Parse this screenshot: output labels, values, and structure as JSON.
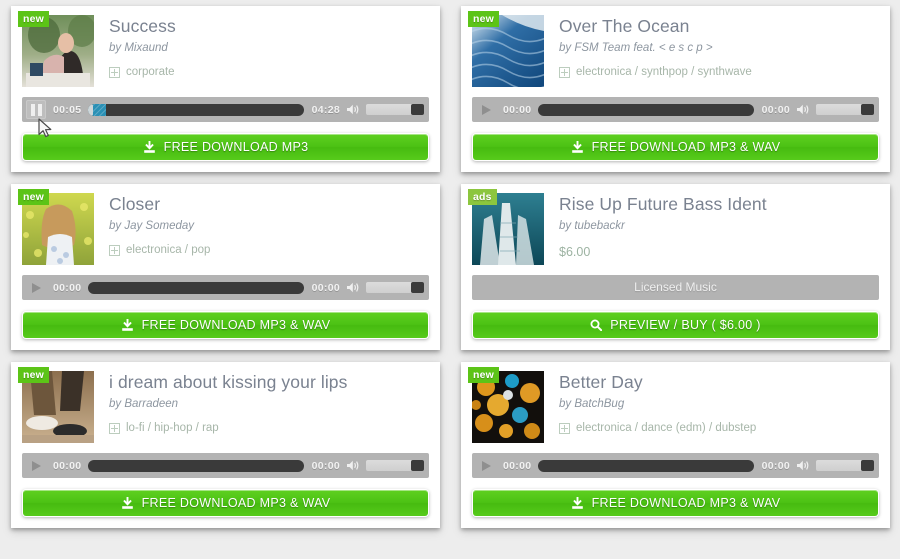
{
  "page": {
    "background_color": "#ededed",
    "card_background": "#ffffff",
    "accent_green": "#4cc214",
    "badge_new_color": "#5cc417",
    "badge_ads_color": "#8cc63e",
    "player_bar_color": "#b3b3b3",
    "progress_played_color": "#2a90b5",
    "title_color": "#7a8290"
  },
  "icons": {
    "expand_tag": "plus-square-icon",
    "download": "download-icon",
    "search": "magnifier-icon",
    "speaker": "volume-icon",
    "play": "play-icon",
    "pause": "pause-icon",
    "cursor": "mouse-arrow-cursor"
  },
  "cards": [
    {
      "badge": "new",
      "badge_type": "new",
      "title": "Success",
      "artist": "by Mixaund",
      "tags": "corporate",
      "thumb": "woman-at-laptop-photo",
      "player": {
        "state": "playing",
        "current_time": "00:05",
        "duration": "04:28",
        "progress_percent": 8,
        "volume_percent": 100
      },
      "button": {
        "label": "FREE DOWNLOAD  MP3",
        "icon": "download",
        "style": "green"
      }
    },
    {
      "badge": "new",
      "badge_type": "new",
      "title": "Over The Ocean",
      "artist": "by FSM Team feat. < e s c p >",
      "tags": "electronica / synthpop / synthwave",
      "thumb": "ocean-waves-photo",
      "player": {
        "state": "paused",
        "current_time": "00:00",
        "duration": "00:00",
        "progress_percent": 0,
        "volume_percent": 100
      },
      "button": {
        "label": "FREE DOWNLOAD  MP3 & WAV",
        "icon": "download",
        "style": "green"
      }
    },
    {
      "badge": "new",
      "badge_type": "new",
      "title": "Closer",
      "artist": "by Jay Someday",
      "tags": "electronica / pop",
      "thumb": "woman-in-field-photo",
      "player": {
        "state": "paused",
        "current_time": "00:00",
        "duration": "00:00",
        "progress_percent": 0,
        "volume_percent": 100
      },
      "button": {
        "label": "FREE DOWNLOAD  MP3 & WAV",
        "icon": "download",
        "style": "green"
      }
    },
    {
      "badge": "ads",
      "badge_type": "ads",
      "title": "Rise Up Future Bass Ident",
      "artist": "by tubebackr",
      "price": "$6.00",
      "thumb": "skyscrapers-photo",
      "licensed_label": "Licensed Music",
      "button": {
        "label": "PREVIEW / BUY ( $6.00 )",
        "icon": "search",
        "style": "green"
      }
    },
    {
      "badge": "new",
      "badge_type": "new",
      "title": "i dream about kissing your lips",
      "artist": "by Barradeen",
      "tags": "lo-fi / hip-hop / rap",
      "thumb": "feet-sneakers-photo",
      "player": {
        "state": "paused",
        "current_time": "00:00",
        "duration": "00:00",
        "progress_percent": 0,
        "volume_percent": 100
      },
      "button": {
        "label": "FREE DOWNLOAD  MP3 & WAV",
        "icon": "download",
        "style": "green"
      }
    },
    {
      "badge": "new",
      "badge_type": "new",
      "title": "Better Day",
      "artist": "by BatchBug",
      "tags": "electronica / dance (edm) / dubstep",
      "thumb": "orange-bokeh-photo",
      "player": {
        "state": "paused",
        "current_time": "00:00",
        "duration": "00:00",
        "progress_percent": 0,
        "volume_percent": 100
      },
      "button": {
        "label": "FREE DOWNLOAD  MP3 & WAV",
        "icon": "download",
        "style": "green"
      }
    }
  ]
}
